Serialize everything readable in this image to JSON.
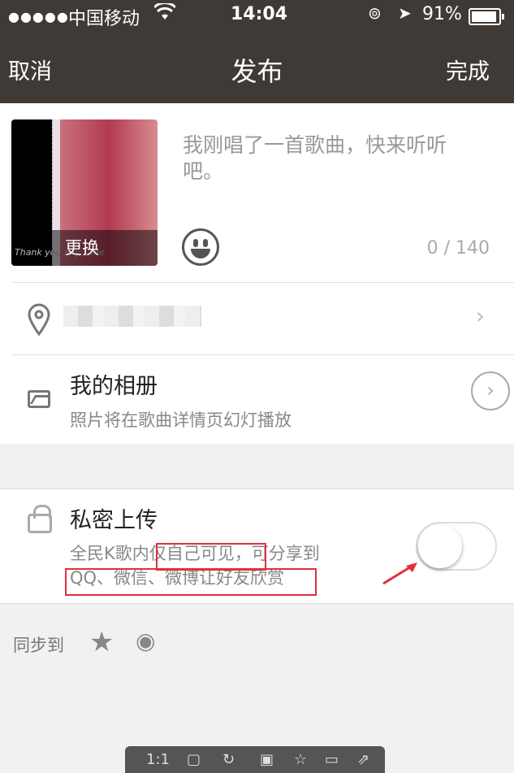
{
  "status_bar": {
    "signal": "●●●●●",
    "carrier": "中国移动",
    "wifi_icon": "wifi-icon",
    "time": "14:04",
    "battery": "91%"
  },
  "nav": {
    "cancel": "取消",
    "title": "发布",
    "done": "完成"
  },
  "cover": {
    "swap_label": "更换",
    "signature": "Thank you Sky Lane"
  },
  "caption": {
    "placeholder": "我刚唱了一首歌曲，快来听听吧。",
    "counter": "0 / 140"
  },
  "album": {
    "title": "我的相册",
    "subtitle": "照片将在歌曲详情页幻灯播放"
  },
  "private": {
    "title": "私密上传",
    "desc_line1": "全民K歌内仅自己可见，可分享到",
    "desc_line2": "QQ、微信、微博让好友欣赏",
    "enabled": false
  },
  "sync": {
    "label": "同步到"
  },
  "toolbar": {
    "zoom": "1:1"
  },
  "colors": {
    "nav_bg": "#403a36",
    "highlight": "#e0303a"
  }
}
